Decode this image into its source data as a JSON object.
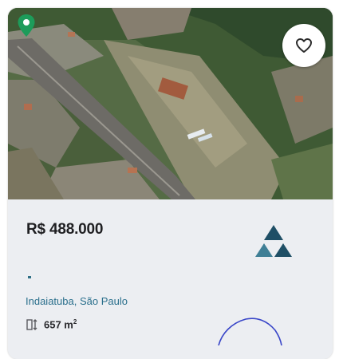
{
  "listing": {
    "price": "R$ 488.000",
    "location": "Indaiatuba, São Paulo",
    "area_value": "657 m",
    "area_unit_sup": "2",
    "separator": "-"
  },
  "icons": {
    "pin": "map-pin-icon",
    "favorite": "heart-icon",
    "area": "area-ruler-icon",
    "logo": "triangles-logo"
  },
  "colors": {
    "card_bg": "#eceef2",
    "pin": "#1d9c5a",
    "link": "#2a6f8c",
    "logo_dark": "#1f4f66",
    "logo_mid": "#3f7f96",
    "pen": "#3946c8"
  }
}
